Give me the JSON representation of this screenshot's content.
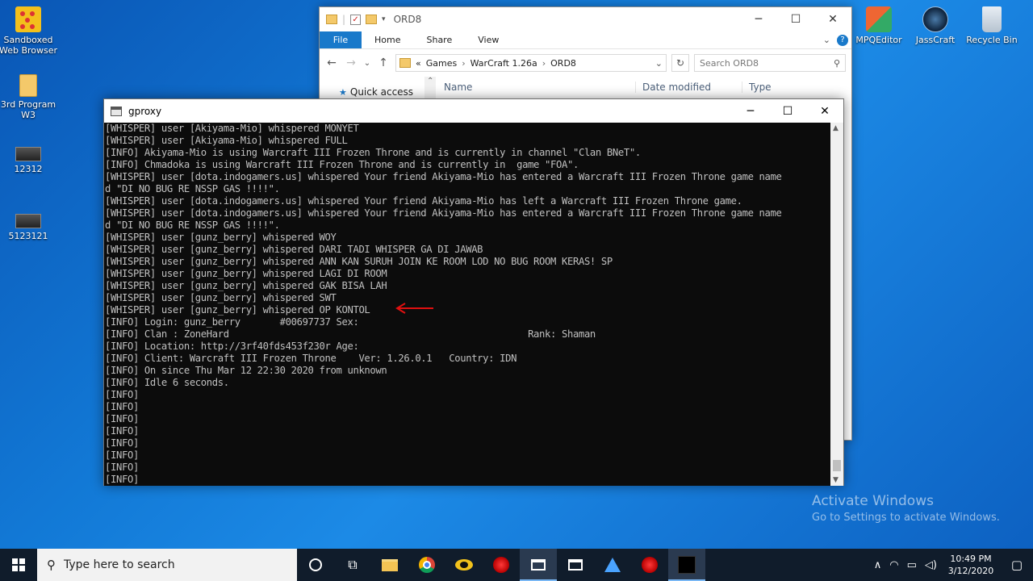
{
  "desktop": {
    "icons": [
      {
        "label": "Sandboxed\nWeb Browser"
      },
      {
        "label": "3rd Program\nW3"
      },
      {
        "label": "12312"
      },
      {
        "label": "5123121"
      },
      {
        "label": "MPQEditor"
      },
      {
        "label": "JassCraft"
      },
      {
        "label": "Recycle Bin"
      }
    ]
  },
  "explorer": {
    "title": "ORD8",
    "ribbon": {
      "file": "File",
      "home": "Home",
      "share": "Share",
      "view": "View"
    },
    "breadcrumb": {
      "prefix": "«",
      "parts": [
        "Games",
        "WarCraft 1.26a",
        "ORD8"
      ]
    },
    "search_placeholder": "Search ORD8",
    "columns": {
      "name": "Name",
      "date": "Date modified",
      "type": "Type"
    },
    "quick_access": "Quick access"
  },
  "console": {
    "title": "gproxy",
    "lines": [
      "[WHISPER] user [Akiyama-Mio] whispered MONYET",
      "[WHISPER] user [Akiyama-Mio] whispered FULL",
      "[INFO] Akiyama-Mio is using Warcraft III Frozen Throne and is currently in channel \"Clan BNeT\".",
      "[INFO] Chmadoka is using Warcraft III Frozen Throne and is currently in  game \"FOA\".",
      "[WHISPER] user [dota.indogamers.us] whispered Your friend Akiyama-Mio has entered a Warcraft III Frozen Throne game name",
      "d \"DI NO BUG RE NSSP GAS !!!!\".",
      "[WHISPER] user [dota.indogamers.us] whispered Your friend Akiyama-Mio has left a Warcraft III Frozen Throne game.",
      "[WHISPER] user [dota.indogamers.us] whispered Your friend Akiyama-Mio has entered a Warcraft III Frozen Throne game name",
      "d \"DI NO BUG RE NSSP GAS !!!!\".",
      "[WHISPER] user [gunz_berry] whispered WOY",
      "[WHISPER] user [gunz_berry] whispered DARI TADI WHISPER GA DI JAWAB",
      "[WHISPER] user [gunz_berry] whispered ANN KAN SURUH JOIN KE ROOM LOD NO BUG ROOM KERAS! SP",
      "[WHISPER] user [gunz_berry] whispered LAGI DI ROOM",
      "[WHISPER] user [gunz_berry] whispered GAK BISA LAH",
      "[WHISPER] user [gunz_berry] whispered SWT",
      "[WHISPER] user [gunz_berry] whispered OP KONTOL",
      "[INFO] Login: gunz_berry       #00697737 Sex:",
      "[INFO] Clan : ZoneHard                                                     Rank: Shaman",
      "[INFO] Location: http://3rf40fds453f230r Age:",
      "[INFO] Client: Warcraft III Frozen Throne    Ver: 1.26.0.1   Country: IDN",
      "[INFO] On since Thu Mar 12 22:30 2020 from unknown",
      "[INFO] Idle 6 seconds.",
      "[INFO]",
      "[INFO]",
      "[INFO]",
      "[INFO]",
      "[INFO]",
      "[INFO]",
      "[INFO]",
      "[INFO]"
    ]
  },
  "watermark": {
    "line1": "Activate Windows",
    "line2": "Go to Settings to activate Windows."
  },
  "taskbar": {
    "search_placeholder": "Type here to search",
    "clock_time": "10:49 PM",
    "clock_date": "3/12/2020"
  },
  "colors": {
    "desktop_bg": "#1279d6",
    "console_bg": "#0c0c0c",
    "console_text": "#c0c0c0",
    "taskbar_bg": "#101c2b",
    "annotation_arrow": "#e01010",
    "ribbon_file": "#1979ca"
  }
}
